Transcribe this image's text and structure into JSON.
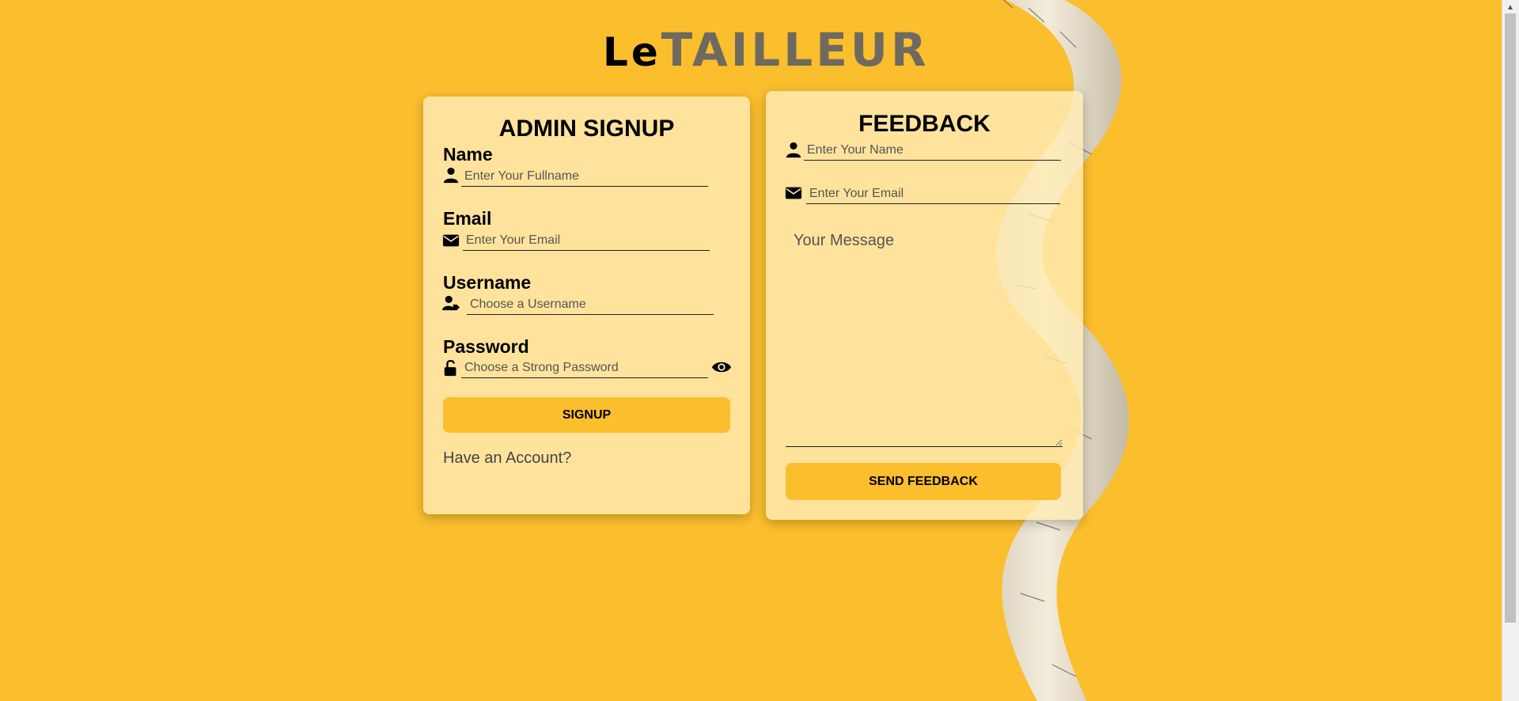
{
  "logo": {
    "le": "Le",
    "tailleur": "TAILLEUR"
  },
  "signup": {
    "title": "ADMIN SIGNUP",
    "name_label": "Name",
    "name_placeholder": "Enter Your Fullname",
    "email_label": "Email",
    "email_placeholder": "Enter Your Email",
    "username_label": "Username",
    "username_placeholder": "Choose a Username",
    "password_label": "Password",
    "password_placeholder": "Choose a Strong Password",
    "button_label": "SIGNUP",
    "account_link": "Have an Account?"
  },
  "feedback": {
    "title": "FEEDBACK",
    "name_placeholder": "Enter Your Name",
    "email_placeholder": "Enter Your Email",
    "message_placeholder": "Your Message",
    "button_label": "SEND FEEDBACK"
  },
  "icons": {
    "user": "user-icon",
    "envelope": "envelope-icon",
    "user-tag": "user-tag-icon",
    "unlock": "unlock-icon",
    "eye": "eye-icon"
  },
  "colors": {
    "background": "#fbbe2d",
    "card": "#ffecb4",
    "button": "#fbbe2d",
    "logo_gray": "#6e6a60"
  }
}
